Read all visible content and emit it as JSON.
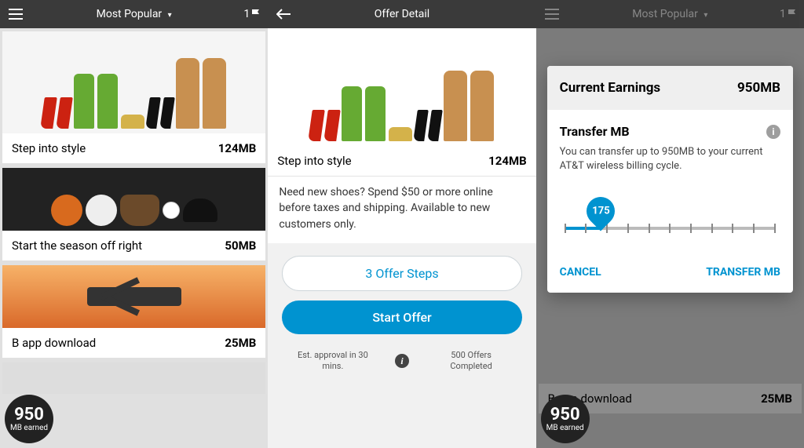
{
  "screen1": {
    "header": {
      "title": "Most Popular",
      "flag_count": "1"
    },
    "offers": [
      {
        "title": "Step into style",
        "value": "124MB"
      },
      {
        "title": "Start the season off right",
        "value": "50MB"
      },
      {
        "title": "B         app download",
        "value": "25MB"
      }
    ],
    "badge": {
      "number": "950",
      "label": "MB earned"
    }
  },
  "screen2": {
    "header": {
      "title": "Offer Detail"
    },
    "offer": {
      "title": "Step into style",
      "value": "124MB"
    },
    "description": "Need new shoes? Spend $50 or more online before taxes and shipping. Available to new customers only.",
    "steps_button": "3 Offer Steps",
    "start_button": "Start Offer",
    "meta_left": "Est. approval in 30 mins.",
    "meta_right": "500 Offers Completed"
  },
  "screen3": {
    "header": {
      "title": "Most Popular",
      "flag_count": "1"
    },
    "dialog": {
      "earnings_label": "Current Earnings",
      "earnings_value": "950MB",
      "transfer_title": "Transfer MB",
      "transfer_desc": "You can transfer up to 950MB to your current AT&T wireless billing cycle.",
      "slider_value": "175",
      "cancel": "CANCEL",
      "confirm": "TRANSFER MB"
    },
    "bg_offer": {
      "title": "B         app download",
      "value": "25MB"
    },
    "badge": {
      "number": "950",
      "label": "MB earned"
    }
  }
}
